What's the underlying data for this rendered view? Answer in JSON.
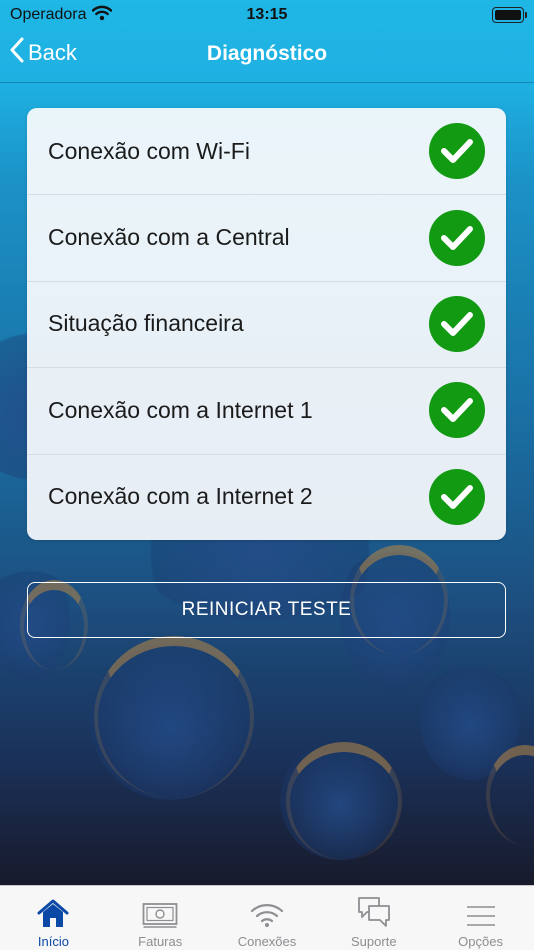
{
  "status_bar": {
    "carrier": "Operadora",
    "time": "13:15"
  },
  "nav": {
    "back_label": "Back",
    "title": "Diagnóstico"
  },
  "checks": [
    {
      "label": "Conexão com Wi-Fi",
      "status": "ok"
    },
    {
      "label": "Conexão com a Central",
      "status": "ok"
    },
    {
      "label": "Situação financeira",
      "status": "ok"
    },
    {
      "label": "Conexão com a Internet 1",
      "status": "ok"
    },
    {
      "label": "Conexão com a Internet 2",
      "status": "ok"
    }
  ],
  "restart_button": {
    "label": "REINICIAR TESTE"
  },
  "tabs": [
    {
      "label": "Início",
      "icon": "home-icon",
      "active": true
    },
    {
      "label": "Faturas",
      "icon": "invoice-icon",
      "active": false
    },
    {
      "label": "Conexões",
      "icon": "wifi-icon",
      "active": false
    },
    {
      "label": "Suporte",
      "icon": "chat-icon",
      "active": false
    },
    {
      "label": "Opções",
      "icon": "menu-icon",
      "active": false
    }
  ],
  "colors": {
    "success": "#119a12",
    "active_tab": "#0b49a6",
    "inactive_tab": "#8e8e93"
  }
}
